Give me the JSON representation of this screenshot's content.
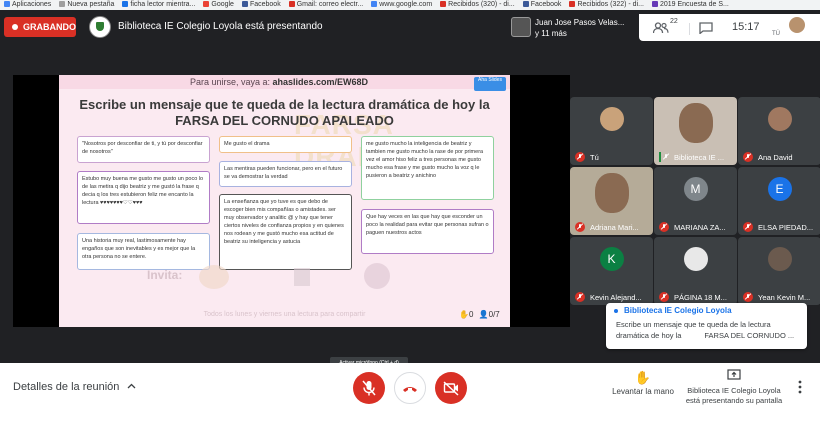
{
  "bookmarks": [
    "Aplicaciones",
    "Nueva pestaña",
    "ficha lector mientra...",
    "Google",
    "Facebook",
    "Gmail: correo electr...",
    "www.google.com",
    "Recibidos (320) - di...",
    "Facebook",
    "Recibidos (322) - di...",
    "2019 Encuesta de S..."
  ],
  "topbar": {
    "recording": "GRABANDO",
    "presenting": "Biblioteca IE Colegio Loyola está presentando",
    "people_name": "Juan Jose Pasos Velas...",
    "people_more": "y 11 más",
    "participants_count": "22",
    "time": "15:17",
    "self_label": "TÚ"
  },
  "slide": {
    "join_prefix": "Para unirse, vaya a: ",
    "join_url": "ahaslides.com/EW68D",
    "brand": "Aha Slides",
    "title_line1": "Escribe un mensaje que te queda de la lectura dramática de hoy la",
    "title_line2": "FARSA DEL CORNUDO APALEADO",
    "cards": [
      "\"Nosotros por desconfiar de ti, y tú por desconfiar de nosotros\"",
      "Estubo muy buena me gusto me gusto un poco lo de las metira q dijo beatriz y me gustó la frase q decia q los tres estubieron feliz me encanto la lectura ♥♥♥♥♥♥♥♡♡♥♥♥",
      "Una historia muy real, lastimosamente hay engaños que son inevitables y es mejor que la otra persona no se entere.",
      "Me gusto el drama",
      "Las mentiras pueden funcionar, pero en el futuro se va demostrar la verdad",
      "La enseñanza que yo tuve es que debo de escoger bien mis compañías o amistades. ser muy observador y analitic @ y hay que tener ciertos niveles de confianza propios y en quienes nos rodean y me gustó mucho esa actitud de beatriz su inteligencia y astucia",
      "me gusto mucho la inteligencia de beatriz y tambien me gusto mucho la rase de por primera vez el amor hiso feliz a tres personas me gusto mucho esa frase y me gusto mucho la voz q le pusieron a beatriz y anichino",
      "Que hay veces en las que hay que esconder un poco la realidad para evitar que personas sufran o paguen nuestros actos"
    ],
    "footer": "Todos los lunes y viernes una lectura para compartir",
    "invite": "Invita:",
    "hands": "0",
    "responders": "0",
    "responders_total": "/7"
  },
  "participants": [
    {
      "name": "Tú",
      "initial": "",
      "color": "#c9a27a"
    },
    {
      "name": "Biblioteca IE ...",
      "initial": "",
      "color": "#b08f6a"
    },
    {
      "name": "Ana David",
      "initial": "",
      "color": "#a07860"
    },
    {
      "name": "Adriana Mari...",
      "initial": "",
      "color": "#8c6e55"
    },
    {
      "name": "MARIANA ZA...",
      "initial": "M",
      "color": "#7f868b"
    },
    {
      "name": "ELSA PIEDAD...",
      "initial": "E",
      "color": "#1a73e8"
    },
    {
      "name": "Kevin Alejand...",
      "initial": "K",
      "color": "#0b8043"
    },
    {
      "name": "PÁGINA 18 M...",
      "initial": "",
      "color": "#e8e8e8"
    },
    {
      "name": "Yean Kevin M...",
      "initial": "",
      "color": "#6b5a4e"
    }
  ],
  "toast": {
    "sender": "Biblioteca IE Colegio Loyola",
    "message": "Escribe un mensaje que te queda de la lectura dramática de hoy la           FARSA DEL CORNUDO ..."
  },
  "tooltip": "Activar micrófono (Ctrl + d)",
  "bottom": {
    "meeting_details": "Detalles de la reunión",
    "raise_hand": "Levantar la mano",
    "presenter_line1": "Biblioteca IE Colegio Loyola",
    "presenter_line2": "está presentando su pantalla"
  },
  "colors": {
    "record": "#d93025",
    "meet_bg": "#202124",
    "tile": "#3c4043"
  }
}
